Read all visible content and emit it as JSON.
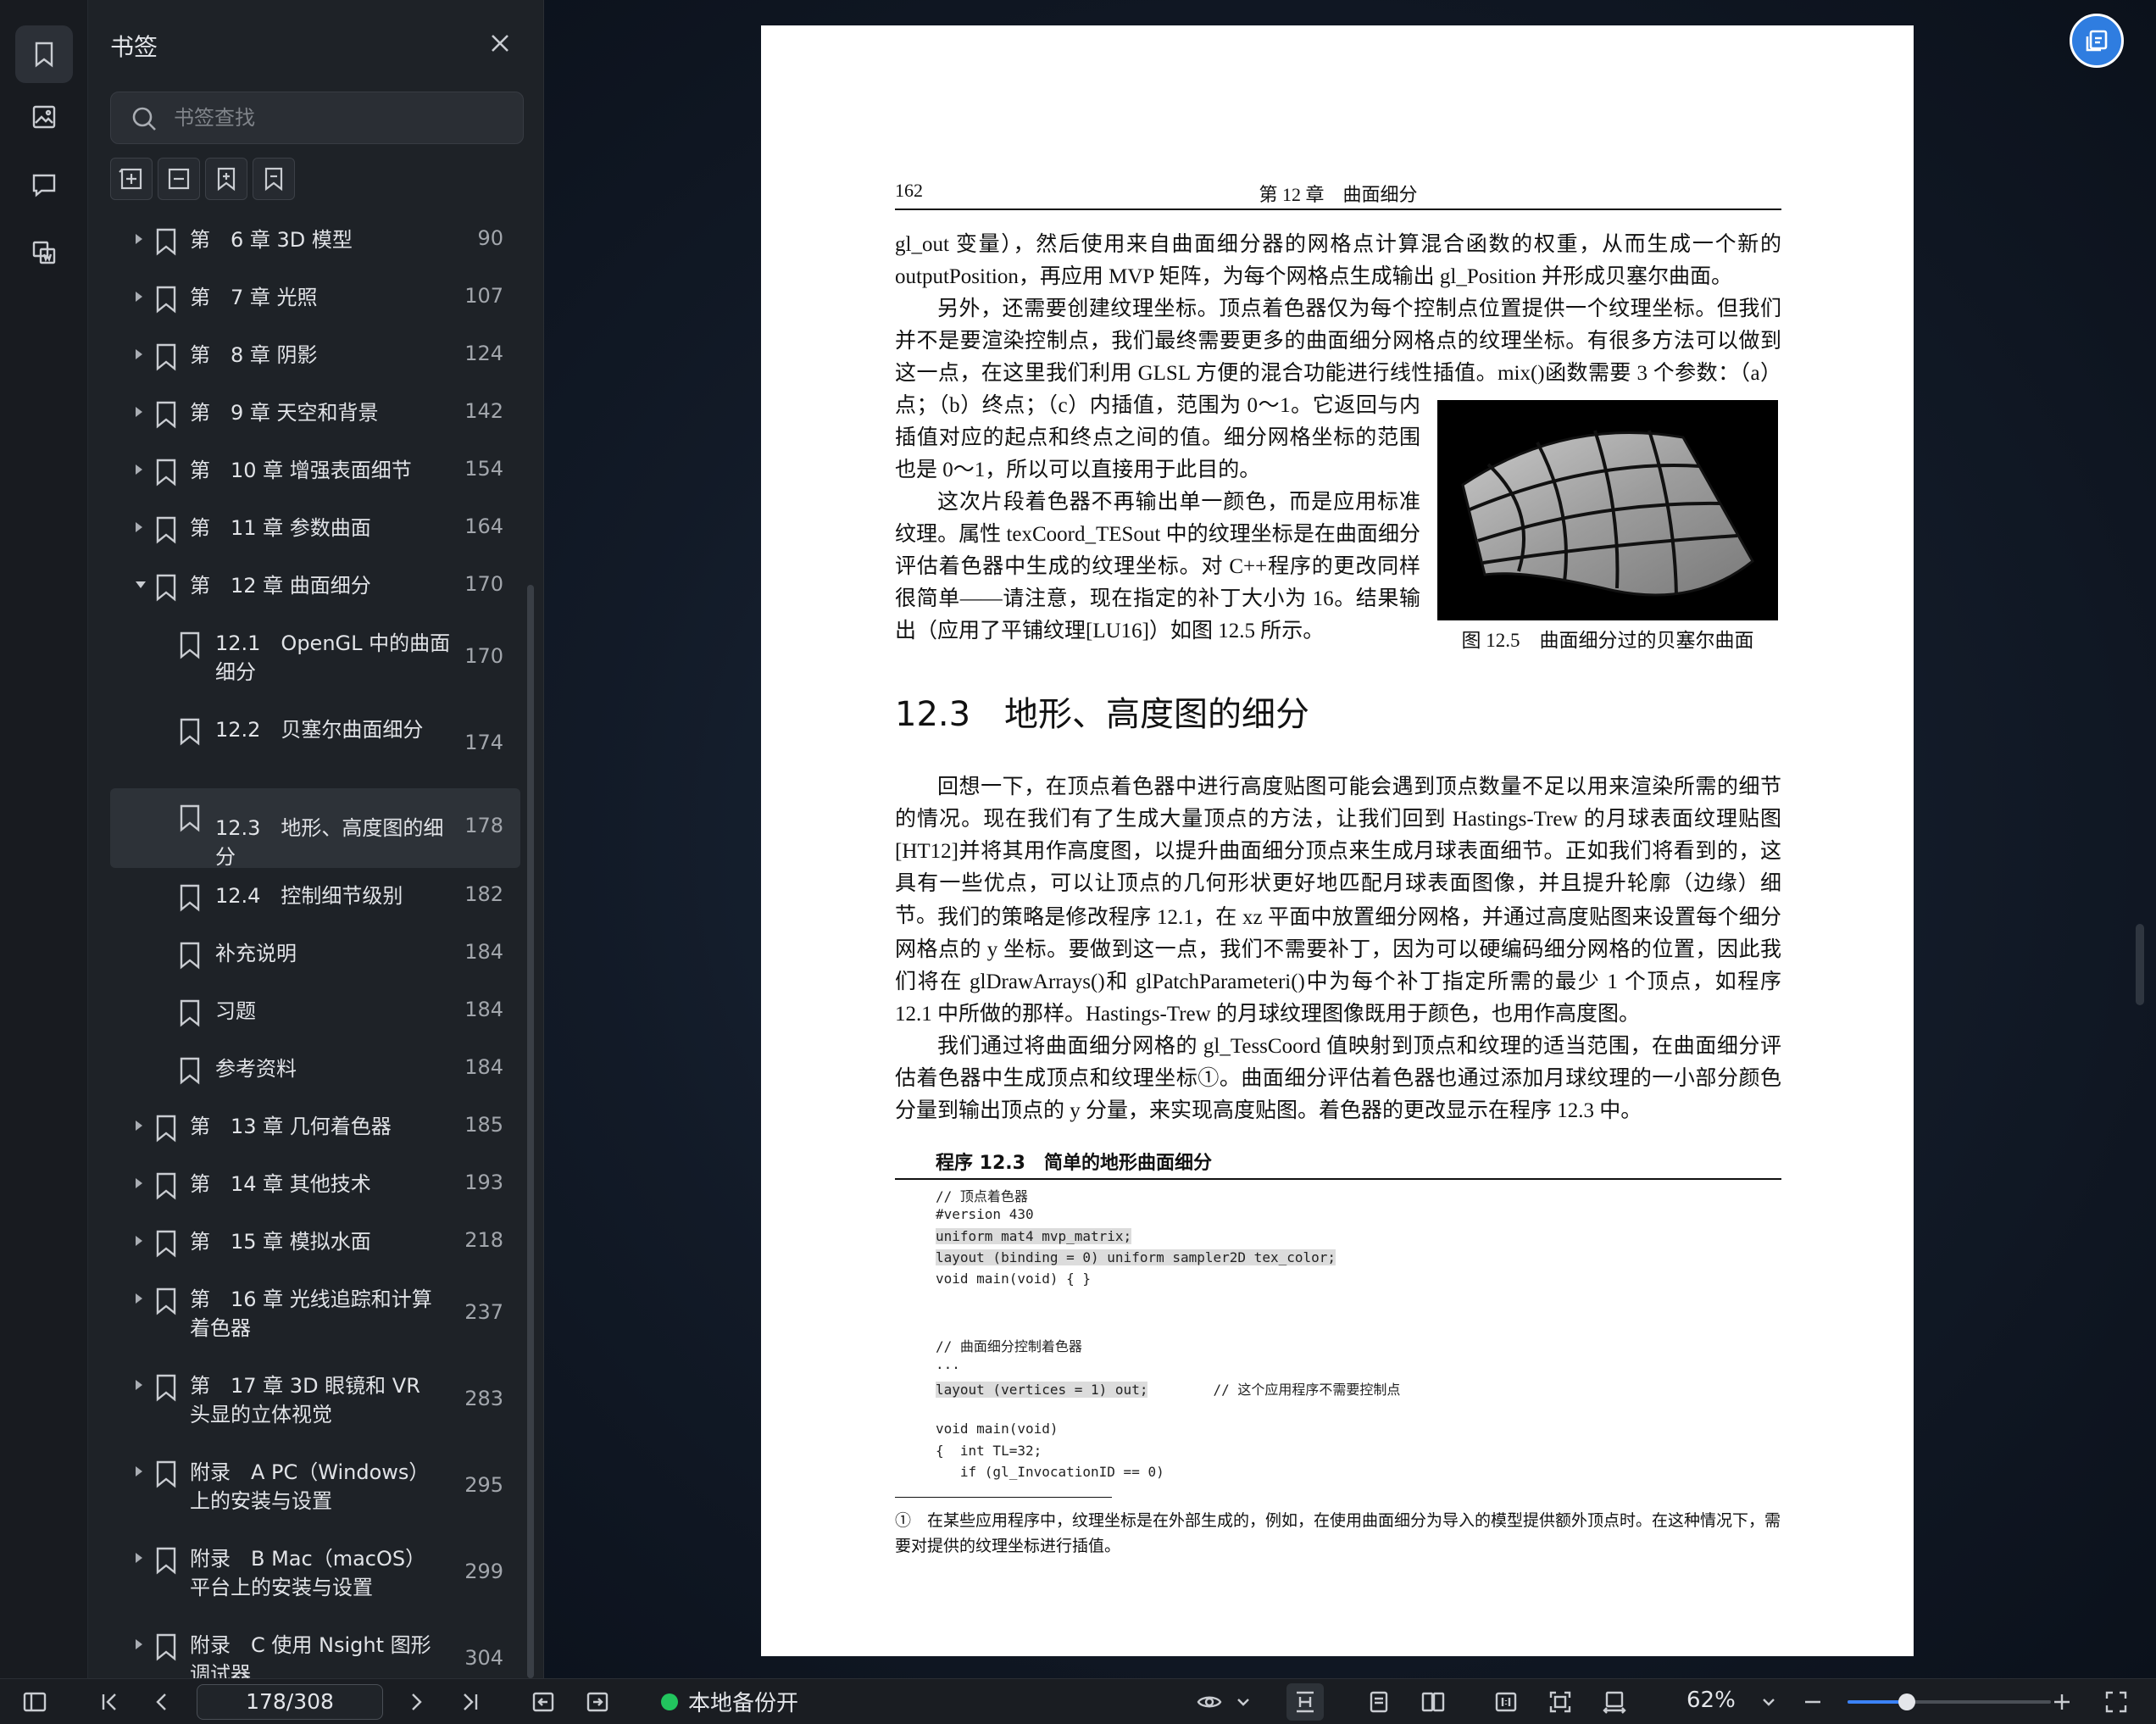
{
  "panel": {
    "title": "书签",
    "search_placeholder": "书签查找"
  },
  "bookmarks": [
    {
      "label": "第　6 章 3D 模型",
      "page": "90",
      "level": 0,
      "state": "collapsed"
    },
    {
      "label": "第　7 章 光照",
      "page": "107",
      "level": 0,
      "state": "collapsed"
    },
    {
      "label": "第　8 章 阴影",
      "page": "124",
      "level": 0,
      "state": "collapsed"
    },
    {
      "label": "第　9 章 天空和背景",
      "page": "142",
      "level": 0,
      "state": "collapsed"
    },
    {
      "label": "第　10 章 增强表面细节",
      "page": "154",
      "level": 0,
      "state": "collapsed"
    },
    {
      "label": "第　11 章 参数曲面",
      "page": "164",
      "level": 0,
      "state": "collapsed"
    },
    {
      "label": "第　12 章 曲面细分",
      "page": "170",
      "level": 0,
      "state": "expanded"
    },
    {
      "label": "12.1　OpenGL 中的曲面细分",
      "page": "170",
      "level": 1,
      "state": "leaf"
    },
    {
      "label": "12.2　贝塞尔曲面细分",
      "page": "174",
      "level": 1,
      "state": "leaf"
    },
    {
      "label": "12.3　地形、高度图的细分",
      "page": "178",
      "level": 1,
      "state": "leaf",
      "selected": true
    },
    {
      "label": "12.4　控制细节级别",
      "page": "182",
      "level": 1,
      "state": "leaf"
    },
    {
      "label": "补充说明",
      "page": "184",
      "level": 1,
      "state": "leaf"
    },
    {
      "label": "习题",
      "page": "184",
      "level": 1,
      "state": "leaf"
    },
    {
      "label": "参考资料",
      "page": "184",
      "level": 1,
      "state": "leaf"
    },
    {
      "label": "第　13 章 几何着色器",
      "page": "185",
      "level": 0,
      "state": "collapsed"
    },
    {
      "label": "第　14 章 其他技术",
      "page": "193",
      "level": 0,
      "state": "collapsed"
    },
    {
      "label": "第　15 章 模拟水面",
      "page": "218",
      "level": 0,
      "state": "collapsed"
    },
    {
      "label": "第　16 章 光线追踪和计算着色器",
      "page": "237",
      "level": 0,
      "state": "collapsed"
    },
    {
      "label": "第　17 章 3D 眼镜和 VR 头显的立体视觉",
      "page": "283",
      "level": 0,
      "state": "collapsed"
    },
    {
      "label": "附录　A PC（Windows）上的安装与设置",
      "page": "295",
      "level": 0,
      "state": "collapsed"
    },
    {
      "label": "附录　B Mac（macOS）平台上的安装与设置",
      "page": "299",
      "level": 0,
      "state": "collapsed"
    },
    {
      "label": "附录　C 使用 Nsight 图形调试器",
      "page": "304",
      "level": 0,
      "state": "collapsed"
    }
  ],
  "document": {
    "page_number": "162",
    "running_title": "第 12 章　曲面细分",
    "p1": "gl_out 变量），然后使用来自曲面细分器的网格点计算混合函数的权重，从而生成一个新的 outputPosition，再应用 MVP 矩阵，为每个网格点生成输出 gl_Position 并形成贝塞尔曲面。",
    "p2": "另外，还需要创建纹理坐标。顶点着色器仅为每个控制点位置提供一个纹理坐标。但我们并不是要渲染控制点，我们最终需要更多的曲面细分网格点的纹理坐标。有很多方法可以做到这一点，在这里我们利用 GLSL 方便的混合功能进行线性插值。mix()函数需要 3 个参数：（a）起",
    "p3": "点；（b）终点；（c）内插值，范围为 0～1。它返回与内插值对应的起点和终点之间的值。细分网格坐标的范围也是 0～1，所以可以直接用于此目的。",
    "p4": "这次片段着色器不再输出单一颜色，而是应用标准纹理。属性 texCoord_TESout 中的纹理坐标是在曲面细分评估着色器中生成的纹理坐标。对 C++程序的更改同样很简单——请注意，现在指定的补丁大小为 16。结果输出（应用了平铺纹理[LU16]）如图 12.5 所示。",
    "fig_caption": "图 12.5　曲面细分过的贝塞尔曲面",
    "section_title": "12.3　地形、高度图的细分",
    "p5": "回想一下，在顶点着色器中进行高度贴图可能会遇到顶点数量不足以用来渲染所需的细节的情况。现在我们有了生成大量顶点的方法，让我们回到 Hastings-Trew 的月球表面纹理贴图[HT12]并将其用作高度图，以提升曲面细分顶点来生成月球表面细节。正如我们将看到的，这具有一些优点，可以让顶点的几何形状更好地匹配月球表面图像，并且提升轮廓（边缘）细节。",
    "p6": "我们的策略是修改程序 12.1，在 xz 平面中放置细分网格，并通过高度贴图来设置每个细分网格点的 y 坐标。要做到这一点，我们不需要补丁，因为可以硬编码细分网格的位置，因此我们将在 glDrawArrays()和 glPatchParameteri()中为每个补丁指定所需的最少 1 个顶点，如程序 12.1 中所做的那样。Hastings-Trew 的月球纹理图像既用于颜色，也用作高度图。",
    "p7": "我们通过将曲面细分网格的 gl_TessCoord 值映射到顶点和纹理的适当范围，在曲面细分评估着色器中生成顶点和纹理坐标①。曲面细分评估着色器也通过添加月球纹理的一小部分颜色分量到输出顶点的 y 分量，来实现高度贴图。着色器的更改显示在程序 12.3 中。",
    "program_title": "程序 12.3　简单的地形曲面细分",
    "code": [
      {
        "text": "// 顶点着色器",
        "hl": false
      },
      {
        "text": "#version 430",
        "hl": false
      },
      {
        "text": "uniform mat4 mvp_matrix;",
        "hl": true
      },
      {
        "text": "layout (binding = 0) uniform sampler2D tex_color;",
        "hl": true
      },
      {
        "text": "void main(void) { }",
        "hl": false
      },
      {
        "text": "",
        "hl": false
      },
      {
        "text": "",
        "hl": false
      },
      {
        "text": "// 曲面细分控制着色器",
        "hl": false
      },
      {
        "text": "...",
        "hl": false
      },
      {
        "text": "layout (vertices = 1) out;",
        "hl": true,
        "comment": "        // 这个应用程序不需要控制点"
      },
      {
        "text": "",
        "hl": false
      },
      {
        "text": "void main(void)",
        "hl": false
      },
      {
        "text": "{  int TL=32;",
        "hl": false
      },
      {
        "text": "   if (gl_InvocationID == 0)",
        "hl": false
      }
    ],
    "footnote": "①　在某些应用程序中，纹理坐标是在外部生成的，例如，在使用曲面细分为导入的模型提供额外顶点时。在这种情况下，需要对提供的纹理坐标进行插值。"
  },
  "toolbar": {
    "page_indicator": "178/308",
    "backup_status": "本地备份开",
    "zoom": "62%",
    "zoom_fraction": 0.29
  }
}
